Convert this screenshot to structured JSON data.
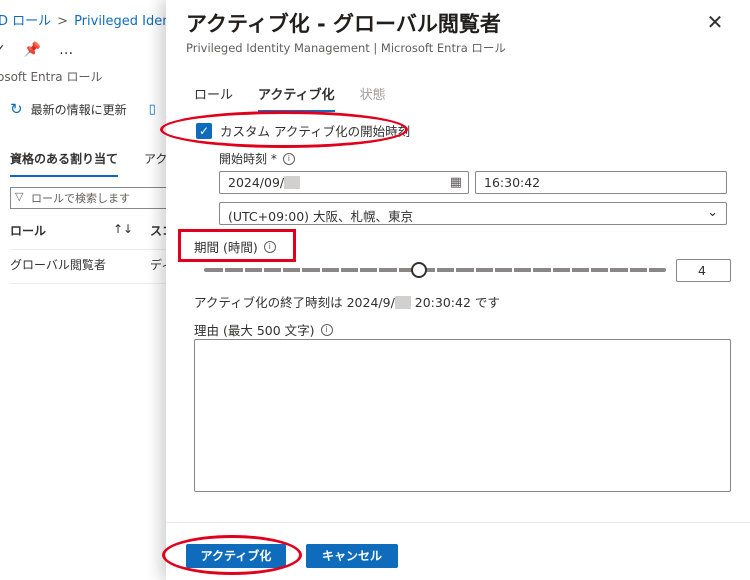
{
  "background": {
    "breadcrumb": [
      "D ロール",
      "Privileged Identi"
    ],
    "toolbar_more": "…",
    "subtitle": "osoft Entra ロール",
    "refresh_label": "最新の情報に更新",
    "tabs": [
      "資格のある割り当て",
      "アク"
    ],
    "search_placeholder": "ロールで検索します",
    "table_header": {
      "role": "ロール",
      "sort": "↑↓",
      "scope": "スコ"
    },
    "table_row": {
      "role": "グローバル閲覧者",
      "scope": "ディ"
    }
  },
  "panel": {
    "title": "アクティブ化 - グローバル閲覧者",
    "subtitle": "Privileged Identity Management | Microsoft Entra ロール",
    "tabs": [
      {
        "label": "ロール",
        "state": "normal"
      },
      {
        "label": "アクティブ化",
        "state": "active"
      },
      {
        "label": "状態",
        "state": "disabled"
      }
    ],
    "custom_start_checkbox": {
      "label": "カスタム アクティブ化の開始時刻",
      "checked": true
    },
    "start_time": {
      "label": "開始時刻 *",
      "date_prefix": "2024/09/",
      "time": "16:30:42"
    },
    "timezone": "(UTC+09:00) 大阪、札幌、東京",
    "duration": {
      "label": "期間 (時間)",
      "value": "4",
      "slider_fraction": 0.466
    },
    "end_time_text": {
      "prefix": "アクティブ化の終了時刻は 2024/9/",
      "suffix": "20:30:42 です"
    },
    "reason": {
      "label": "理由 (最大 500 文字)",
      "value": ""
    },
    "buttons": {
      "activate": "アクティブ化",
      "cancel": "キャンセル"
    }
  },
  "colors": {
    "accent": "#0f6cbd",
    "annotation": "#e0001b"
  }
}
